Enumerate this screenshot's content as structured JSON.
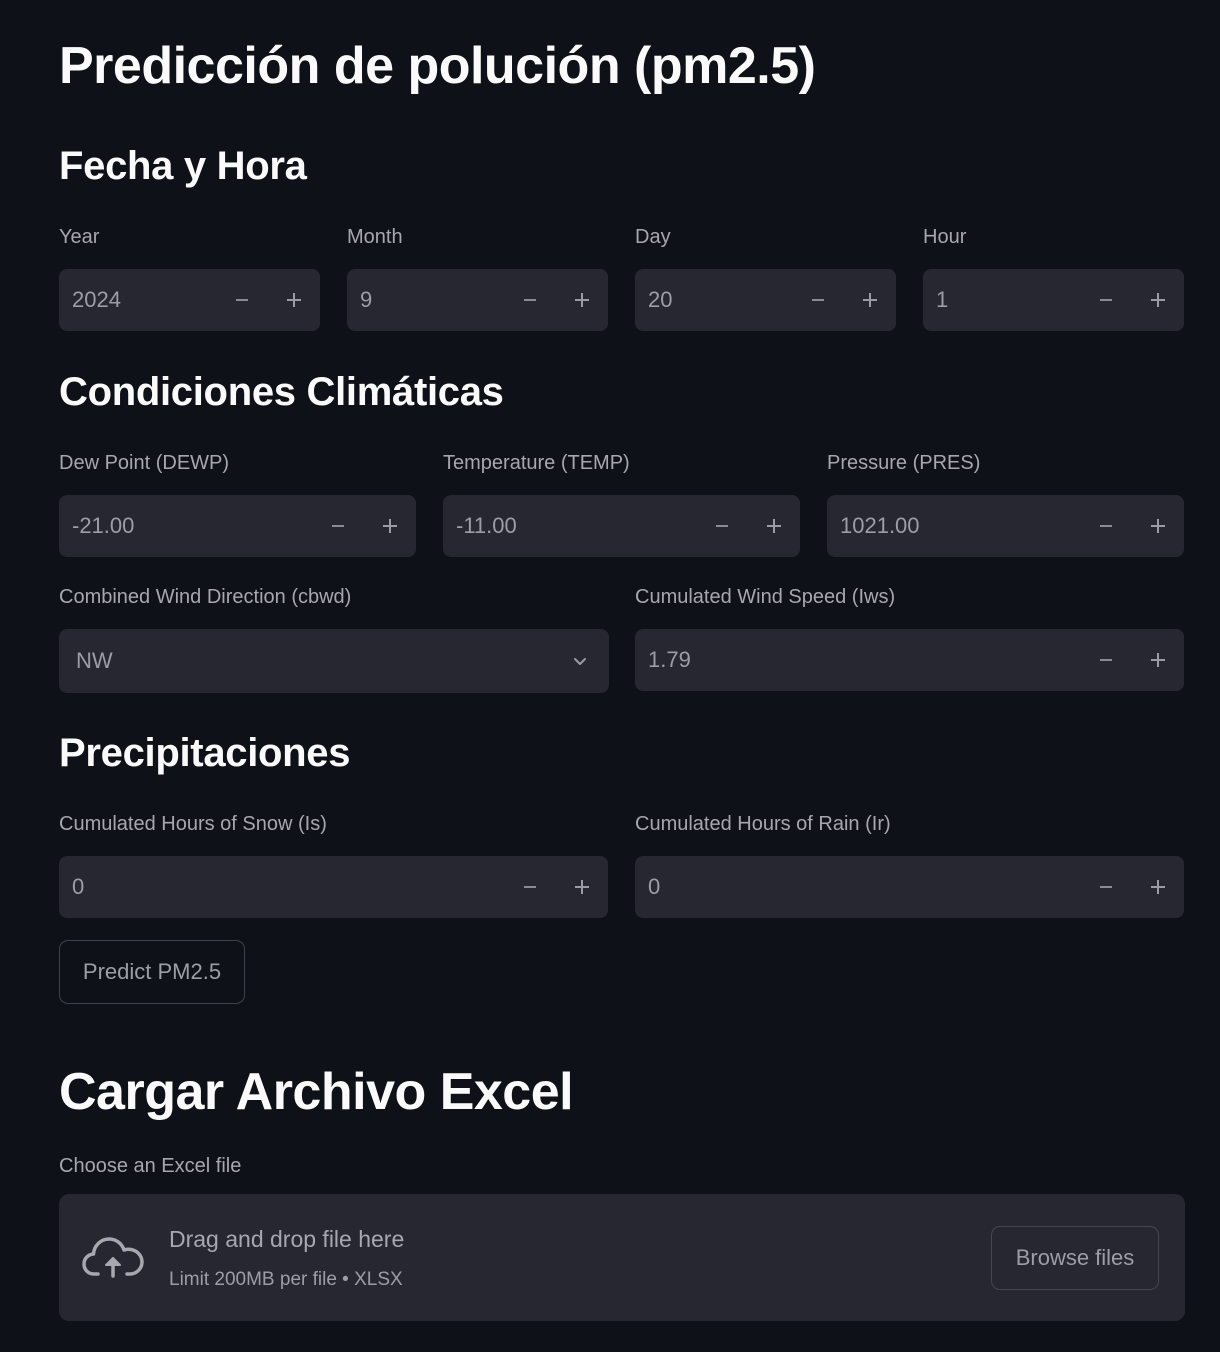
{
  "title": "Predicción de polución (pm2.5)",
  "sections": {
    "datetime": "Fecha y Hora",
    "climate": "Condiciones Climáticas",
    "precip": "Precipitaciones",
    "upload": "Cargar Archivo Excel"
  },
  "datetime_fields": [
    {
      "label": "Year",
      "value": "2024"
    },
    {
      "label": "Month",
      "value": "9"
    },
    {
      "label": "Day",
      "value": "20"
    },
    {
      "label": "Hour",
      "value": "1"
    }
  ],
  "climate_fields": [
    {
      "label": "Dew Point (DEWP)",
      "value": "-21.00"
    },
    {
      "label": "Temperature (TEMP)",
      "value": "-11.00"
    },
    {
      "label": "Pressure (PRES)",
      "value": "1021.00"
    }
  ],
  "wind": {
    "direction_label": "Combined Wind Direction (cbwd)",
    "direction_value": "NW",
    "speed_label": "Cumulated Wind Speed (Iws)",
    "speed_value": "1.79"
  },
  "precip_fields": [
    {
      "label": "Cumulated Hours of Snow (Is)",
      "value": "0"
    },
    {
      "label": "Cumulated Hours of Rain (Ir)",
      "value": "0"
    }
  ],
  "predict_button": "Predict PM2.5",
  "uploader": {
    "label": "Choose an Excel file",
    "title": "Drag and drop file here",
    "subtitle": "Limit 200MB per file • XLSX",
    "browse_button": "Browse files",
    "icon": "cloud-upload-icon"
  },
  "colors": {
    "background": "#0e1117",
    "input_bg": "#262730",
    "text": "#fafafa",
    "muted": "#a6a8ae"
  }
}
